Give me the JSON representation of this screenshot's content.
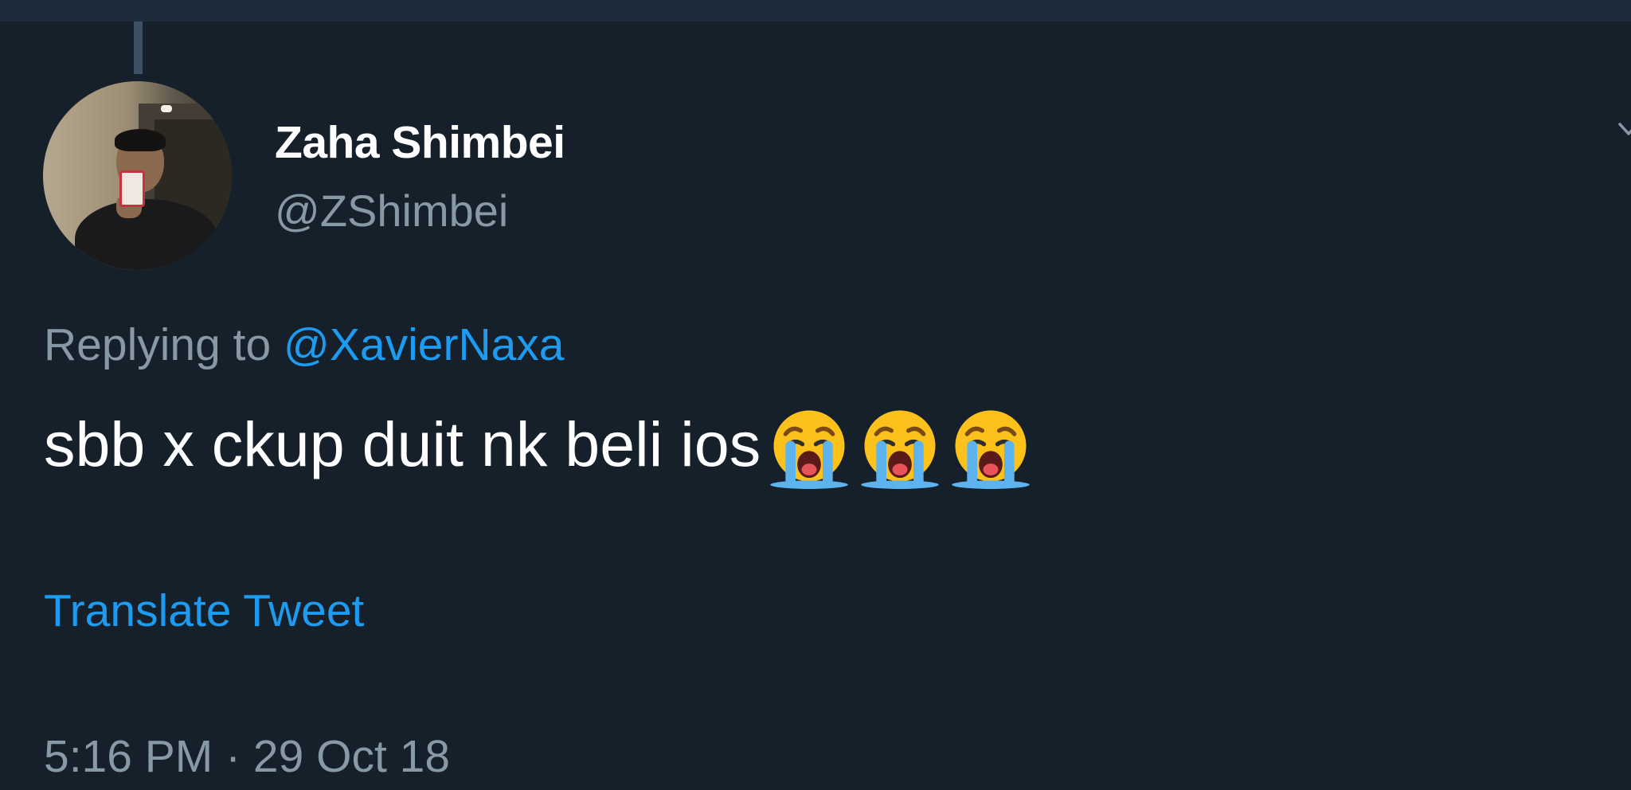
{
  "tweet": {
    "display_name": "Zaha Shimbei",
    "handle": "@ZShimbei",
    "replying_prefix": "Replying to",
    "replying_to": "@XavierNaxa",
    "text": "sbb x ckup duit nk beli ios",
    "emojis": [
      "loudly-crying-face-icon",
      "loudly-crying-face-icon",
      "loudly-crying-face-icon"
    ],
    "translate_label": "Translate Tweet",
    "timestamp": "5:16 PM · 29 Oct 18"
  },
  "colors": {
    "background": "#16202b",
    "topbar": "#1e2b3a",
    "primary_text": "#ffffff",
    "secondary_text": "#8899a6",
    "accent": "#1d9bf0",
    "thread_line": "#3d5064"
  }
}
